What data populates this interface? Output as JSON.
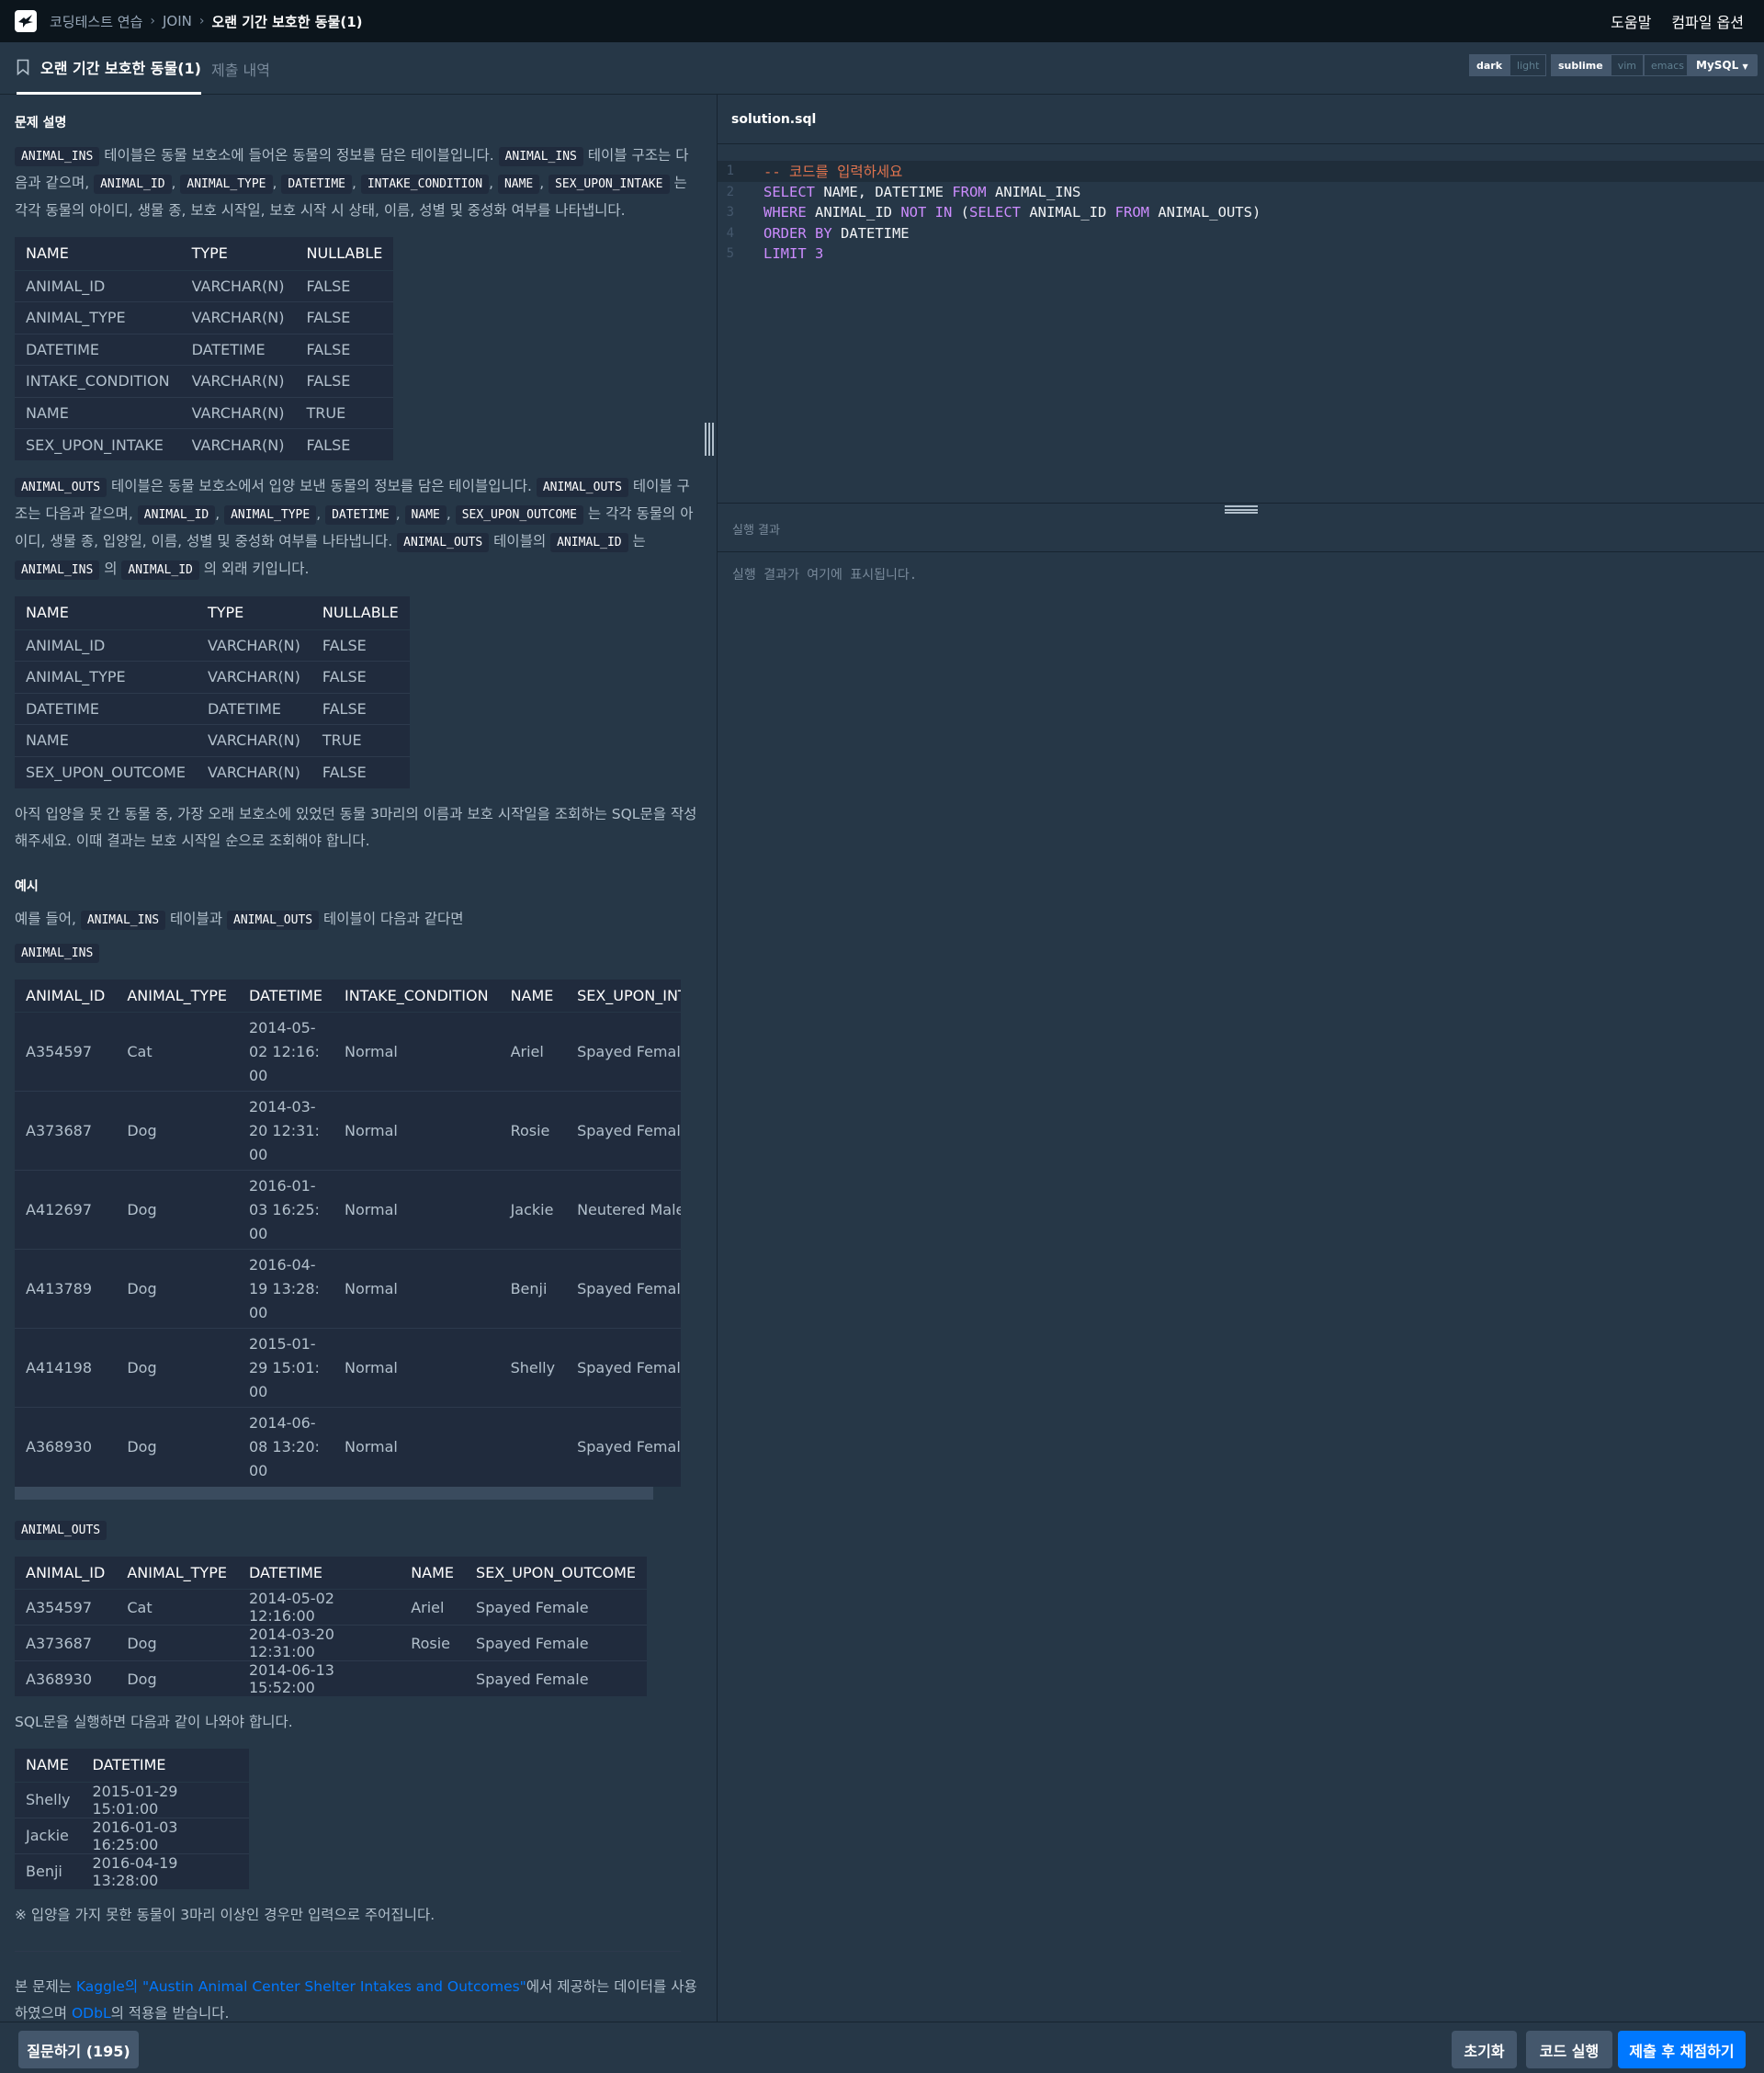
{
  "nav": {
    "crumbs": [
      "코딩테스트 연습",
      "JOIN",
      "오랜 기간 보호한 동물(1)"
    ],
    "help": "도움말",
    "compile_options": "컴파일 옵션"
  },
  "tabs": {
    "active": "오랜 기간 보호한 동물(1)",
    "inactive": "제출 내역"
  },
  "editor_options": {
    "theme": [
      "dark",
      "light"
    ],
    "theme_selected": "dark",
    "keymap": [
      "sublime",
      "vim",
      "emacs"
    ],
    "keymap_selected": "sublime",
    "language": "MySQL"
  },
  "description": {
    "heading": "문제 설명",
    "ins_intro": {
      "parts": [
        "ANIMAL_INS",
        " 테이블은 동물 보호소에 들어온 동물의 정보를 담은 테이블입니다. ",
        "ANIMAL_INS",
        " 테이블 구조는 다음과 같으며, ",
        "ANIMAL_ID",
        ", ",
        "ANIMAL_TYPE",
        ", ",
        "DATETIME",
        ", ",
        "INTAKE_CONDITION",
        ", ",
        "NAME",
        ", ",
        "SEX_UPON_INTAKE",
        " 는 각각 동물의 아이디, 생물 종, 보호 시작일, 보호 시작 시 상태, 이름, 성별 및 중성화 여부를 나타냅니다."
      ]
    },
    "ins_schema": {
      "headers": [
        "NAME",
        "TYPE",
        "NULLABLE"
      ],
      "rows": [
        [
          "ANIMAL_ID",
          "VARCHAR(N)",
          "FALSE"
        ],
        [
          "ANIMAL_TYPE",
          "VARCHAR(N)",
          "FALSE"
        ],
        [
          "DATETIME",
          "DATETIME",
          "FALSE"
        ],
        [
          "INTAKE_CONDITION",
          "VARCHAR(N)",
          "FALSE"
        ],
        [
          "NAME",
          "VARCHAR(N)",
          "TRUE"
        ],
        [
          "SEX_UPON_INTAKE",
          "VARCHAR(N)",
          "FALSE"
        ]
      ]
    },
    "outs_intro": {
      "parts": [
        "ANIMAL_OUTS",
        " 테이블은 동물 보호소에서 입양 보낸 동물의 정보를 담은 테이블입니다. ",
        "ANIMAL_OUTS",
        " 테이블 구조는 다음과 같으며, ",
        "ANIMAL_ID",
        ", ",
        "ANIMAL_TYPE",
        ", ",
        "DATETIME",
        ", ",
        "NAME",
        ", ",
        "SEX_UPON_OUTCOME",
        " 는 각각 동물의 아이디, 생물 종, 입양일, 이름, 성별 및 중성화 여부를 나타냅니다. ",
        "ANIMAL_OUTS",
        " 테이블의 ",
        "ANIMAL_ID",
        " 는 ",
        "ANIMAL_INS",
        " 의 ",
        "ANIMAL_ID",
        " 의 외래 키입니다."
      ]
    },
    "outs_schema": {
      "headers": [
        "NAME",
        "TYPE",
        "NULLABLE"
      ],
      "rows": [
        [
          "ANIMAL_ID",
          "VARCHAR(N)",
          "FALSE"
        ],
        [
          "ANIMAL_TYPE",
          "VARCHAR(N)",
          "FALSE"
        ],
        [
          "DATETIME",
          "DATETIME",
          "FALSE"
        ],
        [
          "NAME",
          "VARCHAR(N)",
          "TRUE"
        ],
        [
          "SEX_UPON_OUTCOME",
          "VARCHAR(N)",
          "FALSE"
        ]
      ]
    },
    "task": "아직 입양을 못 간 동물 중, 가장 오래 보호소에 있었던 동물 3마리의 이름과 보호 시작일을 조회하는 SQL문을 작성해주세요. 이때 결과는 보호 시작일 순으로 조회해야 합니다.",
    "example_heading": "예시",
    "example_intro_parts": [
      "예를 들어, ",
      "ANIMAL_INS",
      " 테이블과 ",
      "ANIMAL_OUTS",
      " 테이블이 다음과 같다면"
    ],
    "example_ins_label": "ANIMAL_INS",
    "example_ins": {
      "headers": [
        "ANIMAL_ID",
        "ANIMAL_TYPE",
        "DATETIME",
        "INTAKE_CONDITION",
        "NAME",
        "SEX_UPON_INTAKE"
      ],
      "rows": [
        [
          "A354597",
          "Cat",
          "2014-05-02 12:16:00",
          "Normal",
          "Ariel",
          "Spayed Female"
        ],
        [
          "A373687",
          "Dog",
          "2014-03-20 12:31:00",
          "Normal",
          "Rosie",
          "Spayed Female"
        ],
        [
          "A412697",
          "Dog",
          "2016-01-03 16:25:00",
          "Normal",
          "Jackie",
          "Neutered Male"
        ],
        [
          "A413789",
          "Dog",
          "2016-04-19 13:28:00",
          "Normal",
          "Benji",
          "Spayed Female"
        ],
        [
          "A414198",
          "Dog",
          "2015-01-29 15:01:00",
          "Normal",
          "Shelly",
          "Spayed Female"
        ],
        [
          "A368930",
          "Dog",
          "2014-06-08 13:20:00",
          "Normal",
          "",
          "Spayed Female"
        ]
      ]
    },
    "example_outs_label": "ANIMAL_OUTS",
    "example_outs": {
      "headers": [
        "ANIMAL_ID",
        "ANIMAL_TYPE",
        "DATETIME",
        "NAME",
        "SEX_UPON_OUTCOME"
      ],
      "rows": [
        [
          "A354597",
          "Cat",
          "2014-05-02 12:16:00",
          "Ariel",
          "Spayed Female"
        ],
        [
          "A373687",
          "Dog",
          "2014-03-20 12:31:00",
          "Rosie",
          "Spayed Female"
        ],
        [
          "A368930",
          "Dog",
          "2014-06-13 15:52:00",
          "",
          "Spayed Female"
        ]
      ]
    },
    "result_intro": "SQL문을 실행하면 다음과 같이 나와야 합니다.",
    "result_table": {
      "headers": [
        "NAME",
        "DATETIME"
      ],
      "rows": [
        [
          "Shelly",
          "2015-01-29 15:01:00"
        ],
        [
          "Jackie",
          "2016-01-03 16:25:00"
        ],
        [
          "Benji",
          "2016-04-19 13:28:00"
        ]
      ]
    },
    "note": "※ 입양을 가지 못한 동물이 3마리 이상인 경우만 입력으로 주어집니다.",
    "source": {
      "prefix": "본 문제는 ",
      "link1": "Kaggle의 \"Austin Animal Center Shelter Intakes and Outcomes\"",
      "middle": "에서 제공하는 데이터를 사용하였으며 ",
      "link2": "ODbL",
      "suffix": "의 적용을 받습니다."
    }
  },
  "editor": {
    "filename": "solution.sql",
    "lines": [
      [
        {
          "t": "-- 코드를 입력하세요",
          "c": "cmt"
        }
      ],
      [
        {
          "t": "SELECT",
          "c": "kw"
        },
        {
          "t": " NAME, DATETIME ",
          "c": "id"
        },
        {
          "t": "FROM",
          "c": "kw"
        },
        {
          "t": " ANIMAL_INS",
          "c": "id"
        }
      ],
      [
        {
          "t": "WHERE",
          "c": "kw"
        },
        {
          "t": " ANIMAL_ID ",
          "c": "id"
        },
        {
          "t": "NOT IN",
          "c": "kw"
        },
        {
          "t": " (",
          "c": "id"
        },
        {
          "t": "SELECT",
          "c": "kw"
        },
        {
          "t": " ANIMAL_ID ",
          "c": "id"
        },
        {
          "t": "FROM",
          "c": "kw"
        },
        {
          "t": " ANIMAL_OUTS)",
          "c": "id"
        }
      ],
      [
        {
          "t": "ORDER BY",
          "c": "kw"
        },
        {
          "t": " DATETIME",
          "c": "id"
        }
      ],
      [
        {
          "t": "LIMIT",
          "c": "kw"
        },
        {
          "t": " 3",
          "c": "num"
        }
      ]
    ],
    "result_label": "실행 결과",
    "result_placeholder": "실행 결과가 여기에 표시됩니다."
  },
  "buttons": {
    "ask": "질문하기 (195)",
    "reset": "초기화",
    "run": "코드 실행",
    "submit": "제출 후 채점하기"
  }
}
